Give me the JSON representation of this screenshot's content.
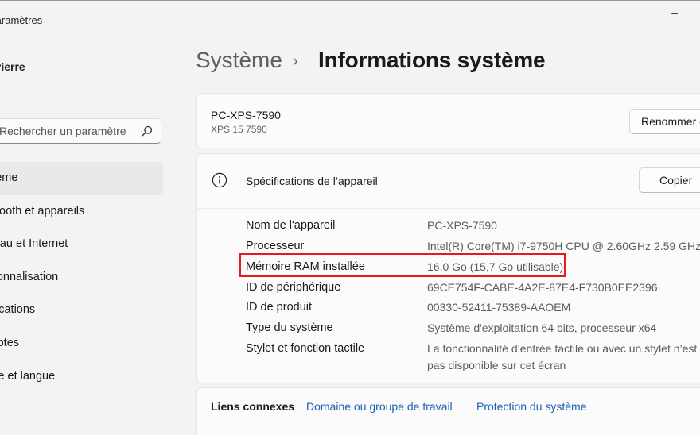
{
  "app": {
    "title": "Paramètres",
    "minimize_symbol": "–"
  },
  "user": {
    "name": "Pierre"
  },
  "search": {
    "placeholder": "Rechercher un paramètre"
  },
  "sidebar": {
    "items": [
      {
        "label": "Système",
        "active": true
      },
      {
        "label": "Bluetooth et appareils"
      },
      {
        "label": "Réseau et Internet"
      },
      {
        "label": "Personnalisation"
      },
      {
        "label": "Applications"
      },
      {
        "label": "Comptes"
      },
      {
        "label": "Heure et langue"
      }
    ]
  },
  "breadcrumb": {
    "parent": "Système",
    "separator": "›",
    "current": "Informations système"
  },
  "device": {
    "name": "PC-XPS-7590",
    "model": "XPS 15 7590",
    "rename_label": "Renommer ce PC"
  },
  "specs": {
    "title": "Spécifications de l’appareil",
    "copy_label": "Copier",
    "rows": [
      {
        "label": "Nom de l'appareil",
        "value": "PC-XPS-7590"
      },
      {
        "label": "Processeur",
        "value": "Intel(R) Core(TM) i7-9750H CPU @ 2.60GHz   2.59 GHz"
      },
      {
        "label": "Mémoire RAM installée",
        "value": "16,0 Go (15,7 Go utilisable)"
      },
      {
        "label": "ID de périphérique",
        "value": "69CE754F-CABE-4A2E-87E4-F730B0EE2396"
      },
      {
        "label": "ID de produit",
        "value": "00330-52411-75389-AAOEM"
      },
      {
        "label": "Type du système",
        "value": "Système d'exploitation 64 bits, processeur x64"
      },
      {
        "label": "Stylet et fonction tactile",
        "value": "La fonctionnalité d’entrée tactile ou avec un stylet n’est",
        "value_line2": "pas disponible sur cet écran"
      }
    ]
  },
  "related": {
    "label": "Liens connexes",
    "links": [
      "Domaine ou groupe de travail",
      "Protection du système"
    ]
  },
  "colors": {
    "highlight": "#e21b1b",
    "link": "#1a5fb4",
    "background": "#f3f3f3",
    "card": "#fbfbfb"
  }
}
